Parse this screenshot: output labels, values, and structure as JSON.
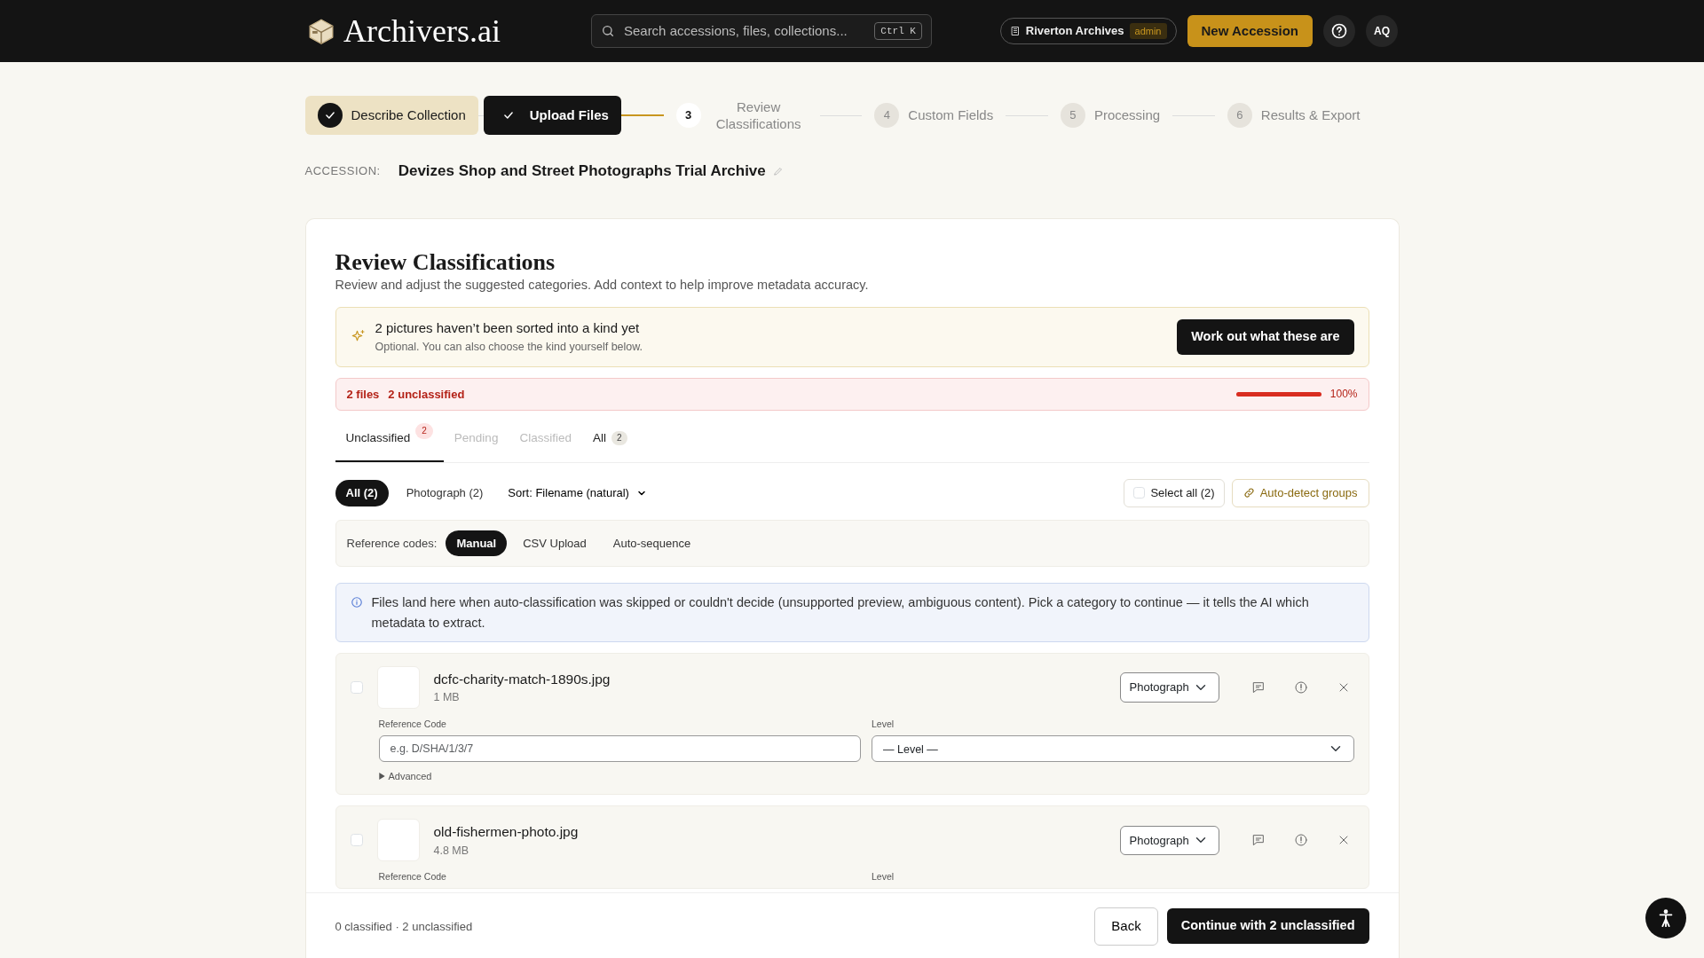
{
  "header": {
    "brand": "Archivers.ai",
    "search": {
      "placeholder": "Search accessions, files, collections...",
      "shortcut": "Ctrl K"
    },
    "org": {
      "name": "Riverton Archives",
      "role": "admin"
    },
    "new_button": "New Accession",
    "avatar": "AQ"
  },
  "steps": [
    {
      "label": "Describe Collection",
      "complete": true,
      "current": false,
      "selected": false
    },
    {
      "label": "Upload Files",
      "complete": true,
      "current": false,
      "selected": true
    },
    {
      "number": "3",
      "label": "Review Classifications",
      "complete": false,
      "current": true,
      "selected": false
    },
    {
      "number": "4",
      "label": "Custom Fields",
      "complete": false,
      "current": false,
      "selected": false
    },
    {
      "number": "5",
      "label": "Processing",
      "complete": false,
      "current": false,
      "selected": false
    },
    {
      "number": "6",
      "label": "Results & Export",
      "complete": false,
      "current": false,
      "selected": false
    }
  ],
  "accession": {
    "label": "ACCESSION:",
    "name": "Devizes Shop and Street Photographs Trial Archive"
  },
  "panel": {
    "title": "Review Classifications",
    "subtitle": "Review and adjust the suggested categories. Add context to help improve metadata accuracy.",
    "notice": {
      "title": "2 pictures haven’t been sorted into a kind yet",
      "text": "Optional. You can also choose the kind yourself below.",
      "button": "Work out what these are"
    },
    "progress": {
      "files": "2 files",
      "unclassified": "2 unclassified",
      "level": 1.0,
      "reading": "100%"
    },
    "tabs": [
      {
        "label": "Unclassified",
        "count": "2",
        "alert": true,
        "selected": true,
        "disabled": false
      },
      {
        "label": "Pending",
        "selected": false,
        "disabled": true
      },
      {
        "label": "Classified",
        "selected": false,
        "disabled": true
      },
      {
        "label": "All",
        "count": "2",
        "alert": false,
        "selected": false,
        "disabled": false
      }
    ],
    "filters": [
      {
        "label": "All (2)",
        "selected": true
      },
      {
        "label": "Photograph (2)",
        "selected": false
      }
    ],
    "sort": "Sort: Filename (natural)",
    "select_all": {
      "label": "Select all (2)",
      "checked": false
    },
    "auto_detect": "Auto-detect groups",
    "reference_codes": {
      "label": "Reference codes:",
      "options": [
        {
          "label": "Manual",
          "selected": true
        },
        {
          "label": "CSV Upload",
          "selected": false
        },
        {
          "label": "Auto-sequence",
          "selected": false
        }
      ]
    },
    "info": "Files land here when auto-classification was skipped or couldn't decide (unsupported preview, ambiguous content). Pick a category to continue — it tells the AI which metadata to extract.",
    "files": [
      {
        "name": "dcfc-charity-match-1890s.jpg",
        "size": "1 MB",
        "category": "Photograph",
        "checked": false,
        "reference_label": "Reference Code",
        "reference_placeholder": "e.g. D/SHA/1/3/7",
        "level_label": "Level",
        "level_value": "— Level —",
        "advanced": "Advanced"
      },
      {
        "name": "old-fishermen-photo.jpg",
        "size": "4.8 MB",
        "category": "Photograph",
        "checked": false,
        "reference_label": "Reference Code",
        "level_label": "Level"
      }
    ],
    "footer": {
      "summary": "0 classified · 2 unclassified",
      "back": "Back",
      "continue": "Continue with 2 unclassified"
    }
  }
}
